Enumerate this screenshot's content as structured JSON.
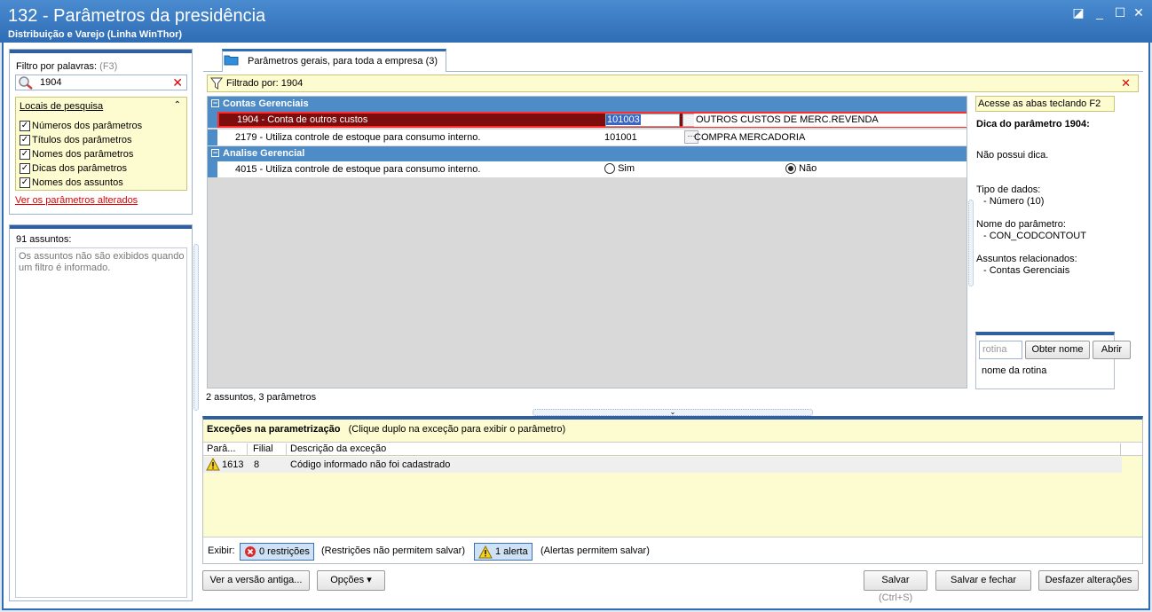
{
  "window": {
    "title": "132 - Parâmetros da presidência",
    "subtitle": "Distribuição e Varejo (Linha WinThor)"
  },
  "sidebar": {
    "filter_label": "Filtro por palavras:",
    "filter_shortcut": "(F3)",
    "search_value": "1904",
    "locais_title": "Locais de pesquisa",
    "locais": [
      {
        "label": "Números dos parâmetros",
        "checked": true
      },
      {
        "label": "Títulos dos parâmetros",
        "checked": true
      },
      {
        "label": "Nomes dos parâmetros",
        "checked": true
      },
      {
        "label": "Dicas dos parâmetros",
        "checked": true
      },
      {
        "label": "Nomes dos assuntos",
        "checked": true
      }
    ],
    "ver_alterados": "Ver os parâmetros alterados",
    "assuntos_count": "91 assuntos:",
    "assuntos_msg": "Os assuntos não são exibidos quando um filtro é informado."
  },
  "tab": {
    "label": "Parâmetros gerais, para toda a empresa",
    "count": "(3)"
  },
  "filterbar": {
    "text": "Filtrado por: 1904"
  },
  "grid": {
    "groups": [
      {
        "name": "Contas Gerenciais"
      },
      {
        "name": "Analise Gerencial"
      }
    ],
    "rows": [
      {
        "name": "1904 - Conta de outros custos",
        "value": "101003",
        "desc": "OUTROS CUSTOS DE MERC.REVENDA"
      },
      {
        "name": "2179 - Utiliza controle de estoque para consumo interno.",
        "value": "101001",
        "desc": "COMPRA MERCADORIA"
      },
      {
        "name": "4015 - Utiliza controle de estoque para consumo interno.",
        "opt_yes": "Sim",
        "opt_no": "Não",
        "selected": "Não"
      }
    ],
    "status": "2 assuntos, 3 parâmetros"
  },
  "hints": {
    "f2": "Acesse as abas teclando F2",
    "dica_title": "Dica do parâmetro 1904:",
    "no_dica": "Não possui dica.",
    "tipo_label": "Tipo de dados:",
    "tipo_value": "- Número (10)",
    "nome_label": "Nome do parâmetro:",
    "nome_value": "- CON_CODCONTOUT",
    "assuntos_label": "Assuntos relacionados:",
    "assuntos_value": "- Contas Gerenciais"
  },
  "rotina": {
    "placeholder": "rotina",
    "obter_label": "Obter nome",
    "abrir_label": "Abrir",
    "hint": "nome da rotina"
  },
  "exceptions": {
    "title": "Exceções na parametrização",
    "subtitle": "(Clique duplo na exceção para exibir o parâmetro)",
    "columns": [
      "Parâ...",
      "Filial",
      "Descrição da exceção"
    ],
    "rows": [
      {
        "param": "1613",
        "filial": "8",
        "desc": "Código informado não foi cadastrado"
      }
    ],
    "exibir_label": "Exibir:",
    "restricoes_label": "0 restrições",
    "restricoes_hint": "(Restrições não permitem salvar)",
    "alertas_label": "1 alerta",
    "alertas_hint": "(Alertas permitem salvar)"
  },
  "footer": {
    "versao_label": "Ver a versão antiga...",
    "opcoes_label": "Opções",
    "salvar_label": "Salvar",
    "salvar_shortcut": "(Ctrl+S)",
    "salvar_fechar_label": "Salvar e fechar",
    "desfazer_label": "Desfazer alterações"
  },
  "colors": {
    "accent": "#2f6db5",
    "group_header": "#4d8cc7",
    "selected_row": "#7d0c0c",
    "hint_bg": "#fdfbd0"
  }
}
